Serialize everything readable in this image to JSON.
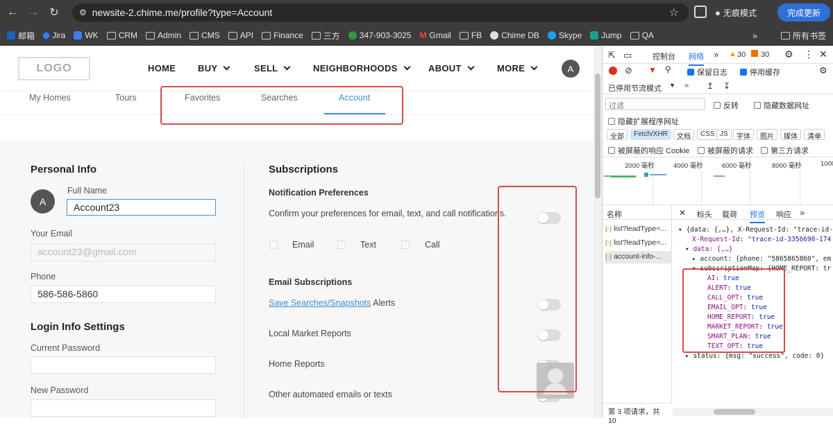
{
  "browser": {
    "url": "newsite-2.chime.me/profile?type=Account",
    "incognito_label": "无痕模式",
    "update_label": "完成更新"
  },
  "bookmarks": {
    "items": [
      "邮箱",
      "Jira",
      "WK",
      "CRM",
      "Admin",
      "CMS",
      "API",
      "Finance",
      "三方",
      "347-903-3025",
      "Gmail",
      "FB",
      "Chime DB",
      "Skype",
      "Jump",
      "QA"
    ],
    "more": "»",
    "all": "所有书签"
  },
  "site": {
    "logo": "LOGO",
    "nav": [
      "HOME",
      "BUY",
      "SELL",
      "NEIGHBORHOODS",
      "ABOUT",
      "MORE"
    ],
    "avatar_letter": "A",
    "subtabs": [
      "My Homes",
      "Tours",
      "Favorites",
      "Searches",
      "Account"
    ]
  },
  "personal": {
    "title": "Personal Info",
    "avatar_letter": "A",
    "fullname_label": "Full Name",
    "fullname_value": "Account23",
    "email_label": "Your Email",
    "email_value": "account23@gmail.com",
    "phone_label": "Phone",
    "phone_value": "586-586-5860",
    "login_title": "Login Info Settings",
    "current_pw_label": "Current Password",
    "new_pw_label": "New Password"
  },
  "subscriptions": {
    "title": "Subscriptions",
    "notif_title": "Notification Preferences",
    "notif_text": "Confirm your preferences for email, text, and call notifications.",
    "channels": [
      "Email",
      "Text",
      "Call"
    ],
    "email_title": "Email Subscriptions",
    "saved_link": "Save Searches/Snapshots",
    "saved_suffix": "Alerts",
    "local_market": "Local Market Reports",
    "home_reports": "Home Reports",
    "other": "Other automated emails or texts"
  },
  "devtools": {
    "tabs": [
      "控制台",
      "网络"
    ],
    "warn_count": "30",
    "err_count": "30",
    "preserve_log": "保留日志",
    "disable_cache": "停用缓存",
    "throttle": "已停用节流模式",
    "filter_placeholder": "过滤",
    "invert": "反转",
    "hide_data_urls": "隐藏数据网址",
    "hide_ext": "隐藏扩展程序网址",
    "types": [
      "全部",
      "Fetch/XHR",
      "文档",
      "CSS",
      "JS",
      "字体",
      "图片",
      "媒体",
      "清单"
    ],
    "blocked_cookies": "被屏蔽的响应 Cookie",
    "blocked_requests": "被屏蔽的请求",
    "third_party": "第三方请求",
    "timeline_labels": [
      "2000 毫秒",
      "4000 毫秒",
      "6000 毫秒",
      "8000 毫秒",
      "1000"
    ],
    "name_header": "名称",
    "detail_tabs": [
      "标头",
      "载荷",
      "预览",
      "响应"
    ],
    "requests": [
      "list?leadType=...",
      "list?leadType=...",
      "account-info-..."
    ],
    "status": "第 3 项请求，共 10",
    "preview": {
      "line1": "{data: {,…}, X-Request-Id: \"trace-id-",
      "line2_key": "X-Request-Id",
      "line2_val": "\"trace-id-3356690-174",
      "line3": "data: {,…}",
      "line4": "account: {phone: \"5865865860\", em",
      "line5": "subscriptionMap: {HOME_REPORT: tr",
      "flags": [
        {
          "k": "AI",
          "v": "true"
        },
        {
          "k": "ALERT",
          "v": "true"
        },
        {
          "k": "CALL_OPT",
          "v": "true"
        },
        {
          "k": "EMAIL_OPT",
          "v": "true"
        },
        {
          "k": "HOME_REPORT",
          "v": "true"
        },
        {
          "k": "MARKET_REPORT",
          "v": "true"
        },
        {
          "k": "SMART_PLAN",
          "v": "true"
        },
        {
          "k": "TEXT_OPT",
          "v": "true"
        }
      ],
      "status_line": "status: {msg: \"success\", code: 0}"
    }
  }
}
